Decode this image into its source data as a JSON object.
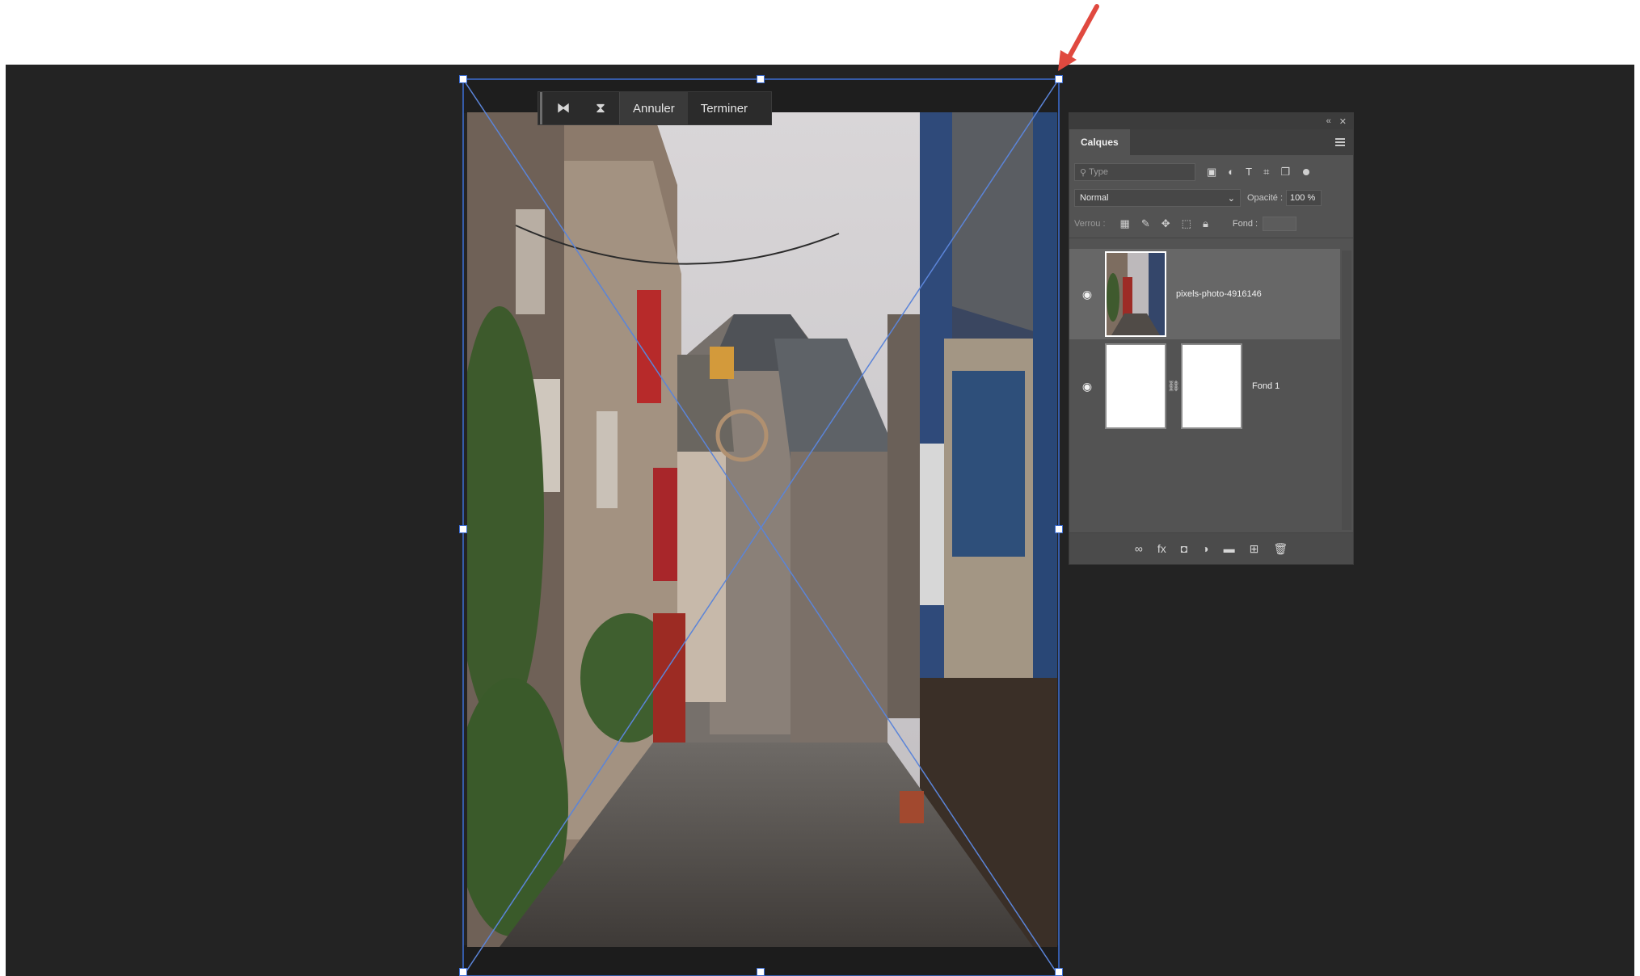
{
  "taskbar": {
    "flip_h_icon": "flip-horizontal-icon",
    "flip_v_icon": "flip-vertical-icon",
    "cancel_label": "Annuler",
    "done_label": "Terminer"
  },
  "layers_panel": {
    "collapse_glyph": "«",
    "close_glyph": "✕",
    "tab_label": "Calques",
    "filter_placeholder": "Type",
    "blend_mode": "Normal",
    "opacity_label": "Opacité :",
    "opacity_value": "100 %",
    "lock_label": "Verrou :",
    "fill_label": "Fond :",
    "layers": [
      {
        "name": "pixels-photo-4916146",
        "visible": true,
        "selected": true
      },
      {
        "name": "Fond 1",
        "visible": true,
        "selected": false,
        "has_mask": true
      }
    ]
  },
  "annotation": {
    "arrow_color": "#e0493f"
  },
  "colors": {
    "workspace": "#232323",
    "panel": "#535353",
    "transform_box": "#3d6fd6"
  }
}
